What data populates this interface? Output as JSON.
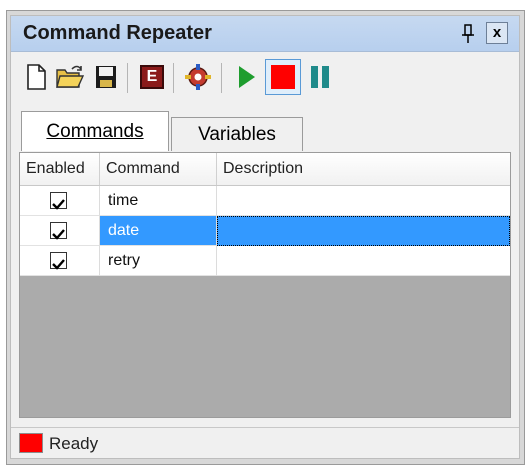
{
  "window": {
    "title": "Command Repeater",
    "close_label": "x"
  },
  "toolbar": {
    "buttons": [
      {
        "name": "new-icon"
      },
      {
        "name": "open-folder-icon"
      },
      {
        "name": "save-icon"
      },
      {
        "name": "edit-e-icon",
        "label": "E"
      },
      {
        "name": "settings-gear-icon"
      },
      {
        "name": "play-icon"
      },
      {
        "name": "stop-icon"
      },
      {
        "name": "pause-icon"
      }
    ]
  },
  "tabs": [
    {
      "label": "Commands",
      "active": true
    },
    {
      "label": "Variables",
      "active": false
    }
  ],
  "grid": {
    "columns": [
      "Enabled",
      "Command",
      "Description"
    ],
    "rows": [
      {
        "enabled": true,
        "command": "time",
        "description": ""
      },
      {
        "enabled": true,
        "command": "date",
        "description": "",
        "selected": true
      },
      {
        "enabled": true,
        "command": "retry",
        "description": ""
      }
    ]
  },
  "status": {
    "text": "Ready",
    "indicator_color": "#ff0000"
  },
  "colors": {
    "title_bg": "#c6d9f1",
    "selection": "#3399ff",
    "empty_area": "#ababab",
    "play": "#1e9d2e",
    "stop": "#ff0000",
    "pause": "#1f8a8a"
  }
}
